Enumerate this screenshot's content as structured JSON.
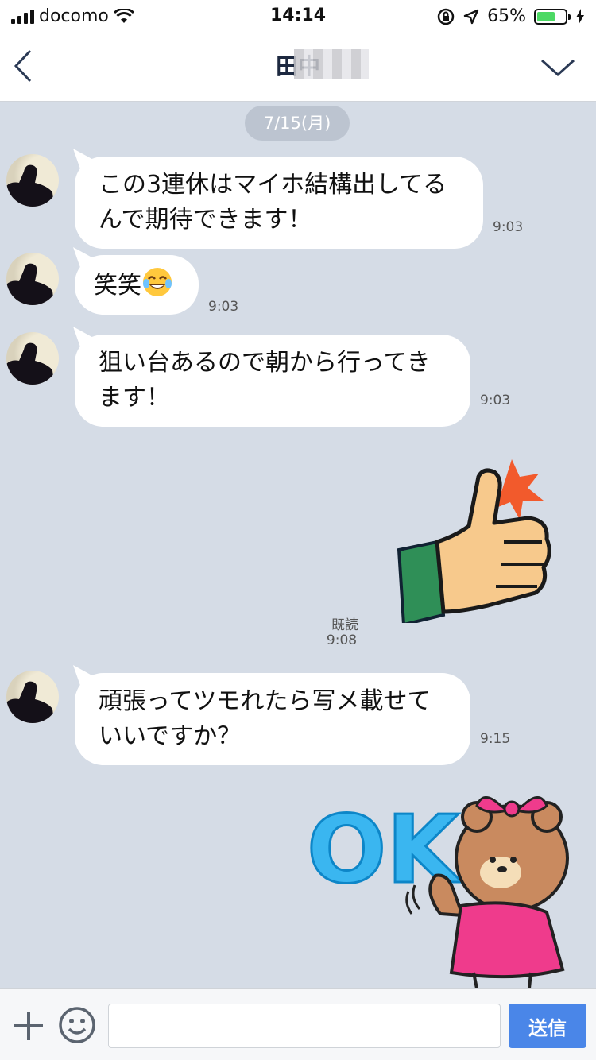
{
  "status_bar": {
    "carrier": "docomo",
    "time": "14:14",
    "battery_percent": "65%",
    "battery_level": 0.65
  },
  "header": {
    "title": "田中"
  },
  "date_separator": "7/15(月)",
  "messages": [
    {
      "text_lines": [
        "この3連休はマイホ結構出してる",
        "んで期待できます！"
      ],
      "time": "9:03"
    },
    {
      "text": "笑笑",
      "emoji": "face-with-tears-of-joy-icon",
      "time": "9:03"
    },
    {
      "text_lines": [
        "狙い台あるので朝から行ってき",
        "ます！"
      ],
      "time": "9:03"
    },
    {
      "sticker": "thumbs-up-sticker",
      "read_label": "既読",
      "time": "9:08"
    },
    {
      "text_lines": [
        "頑張ってツモれたら写メ載せて",
        "いいですか？"
      ],
      "time": "9:15"
    },
    {
      "sticker": "ok-bear-sticker",
      "sticker_text": "OK!"
    }
  ],
  "input_bar": {
    "plus_icon": "plus-icon",
    "emoji_icon": "smiley-icon",
    "placeholder": "",
    "send_label": "送信"
  },
  "colors": {
    "chat_background": "#d5dce6",
    "send_button": "#4a86e8",
    "battery_fill": "#4cd964",
    "date_pill": "#bcc4d0"
  }
}
